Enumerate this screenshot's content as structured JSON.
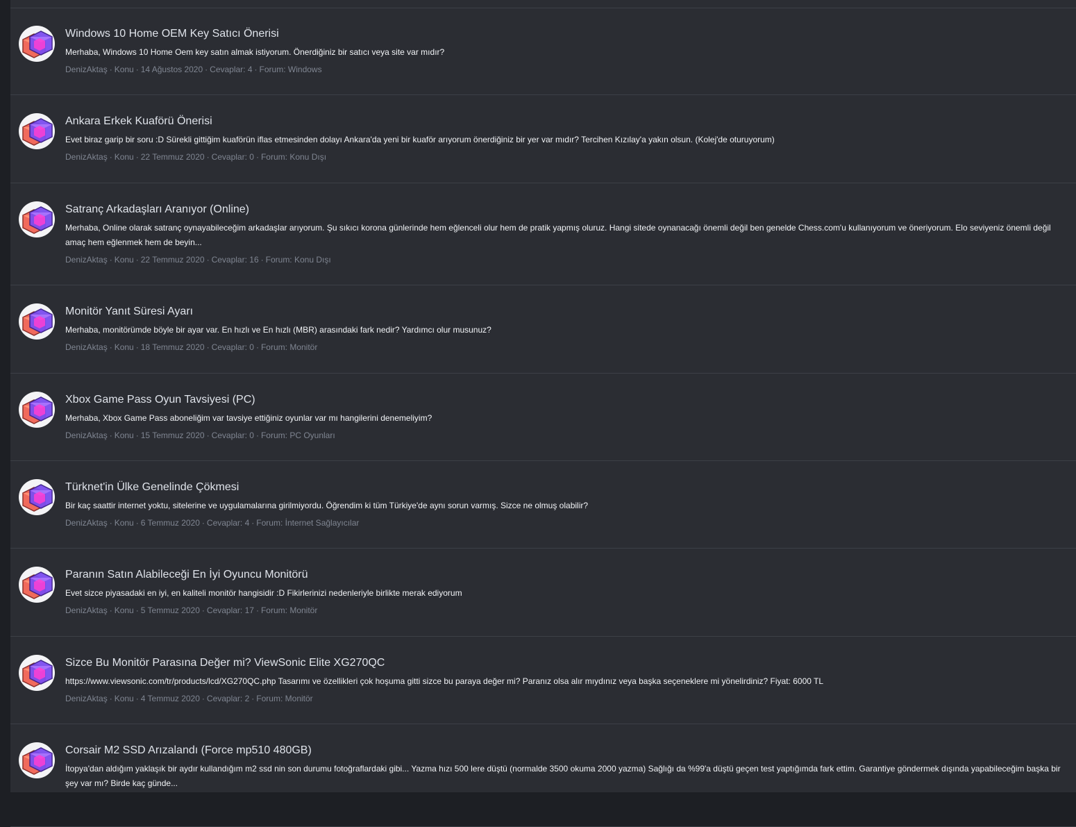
{
  "meta_labels": {
    "type_label": "Konu",
    "replies_label": "Cevaplar:",
    "forum_label": "Forum:",
    "separator": "·"
  },
  "results": [
    {
      "title": "Windows 10 Home OEM Key Satıcı Önerisi",
      "snippet": "Merhaba, Windows 10 Home Oem key satın almak istiyorum. Önerdiğiniz bir satıcı veya site var mıdır?",
      "author": "DenizAktaş",
      "date": "14 Ağustos 2020",
      "replies": "4",
      "forum": "Windows"
    },
    {
      "title": "Ankara Erkek Kuaförü Önerisi",
      "snippet": "Evet biraz garip bir soru :D Sürekli gittiğim kuaförün iflas etmesinden dolayı Ankara'da yeni bir kuaför arıyorum önerdiğiniz bir yer var mıdır? Tercihen Kızılay'a yakın olsun. (Kolej'de oturuyorum)",
      "author": "DenizAktaş",
      "date": "22 Temmuz 2020",
      "replies": "0",
      "forum": "Konu Dışı"
    },
    {
      "title": "Satranç Arkadaşları Aranıyor (Online)",
      "snippet": "Merhaba, Online olarak satranç oynayabileceğim arkadaşlar arıyorum. Şu sıkıcı korona günlerinde hem eğlenceli olur hem de pratik yapmış oluruz. Hangi sitede oynanacağı önemli değil ben genelde Chess.com'u kullanıyorum ve öneriyorum. Elo seviyeniz önemli değil amaç hem eğlenmek hem de beyin...",
      "author": "DenizAktaş",
      "date": "22 Temmuz 2020",
      "replies": "16",
      "forum": "Konu Dışı"
    },
    {
      "title": "Monitör Yanıt Süresi Ayarı",
      "snippet": "Merhaba, monitörümde böyle bir ayar var. En hızlı ve En hızlı (MBR) arasındaki fark nedir? Yardımcı olur musunuz?",
      "author": "DenizAktaş",
      "date": "18 Temmuz 2020",
      "replies": "0",
      "forum": "Monitör"
    },
    {
      "title": "Xbox Game Pass Oyun Tavsiyesi (PC)",
      "snippet": "Merhaba, Xbox Game Pass aboneliğim var tavsiye ettiğiniz oyunlar var mı hangilerini denemeliyim?",
      "author": "DenizAktaş",
      "date": "15 Temmuz 2020",
      "replies": "0",
      "forum": "PC Oyunları"
    },
    {
      "title": "Türknet'in Ülke Genelinde Çökmesi",
      "snippet": "Bir kaç saattir internet yoktu, sitelerine ve uygulamalarına girilmiyordu. Öğrendim ki tüm Türkiye'de aynı sorun varmış. Sizce ne olmuş olabilir?",
      "author": "DenizAktaş",
      "date": "6 Temmuz 2020",
      "replies": "4",
      "forum": "İnternet Sağlayıcılar"
    },
    {
      "title": "Paranın Satın Alabileceği En İyi Oyuncu Monitörü",
      "snippet": "Evet sizce piyasadaki en iyi, en kaliteli monitör hangisidir :D Fikirlerinizi nedenleriyle birlikte merak ediyorum",
      "author": "DenizAktaş",
      "date": "5 Temmuz 2020",
      "replies": "17",
      "forum": "Monitör"
    },
    {
      "title": "Sizce Bu Monitör Parasına Değer mi? ViewSonic Elite XG270QC",
      "snippet": "https://www.viewsonic.com/tr/products/lcd/XG270QC.php Tasarımı ve özellikleri çok hoşuma gitti sizce bu paraya değer mi? Paranız olsa alır mıydınız veya başka seçeneklere mi yönelirdiniz? Fiyat: 6000 TL",
      "author": "DenizAktaş",
      "date": "4 Temmuz 2020",
      "replies": "2",
      "forum": "Monitör"
    },
    {
      "title": "Corsair M2 SSD Arızalandı (Force mp510 480GB)",
      "snippet": "İtopya'dan aldığım yaklaşık bir aydır kullandığım m2 ssd nin son durumu fotoğraflardaki gibi... Yazma hızı 500 lere düştü (normalde 3500 okuma 2000 yazma) Sağlığı da %99'a düştü geçen test yaptığımda fark ettim. Garantiye göndermek dışında yapabileceğim başka bir şey var mı? Birde kaç günde...",
      "author": "DenizAktaş",
      "date": "",
      "replies": "",
      "forum": ""
    }
  ]
}
